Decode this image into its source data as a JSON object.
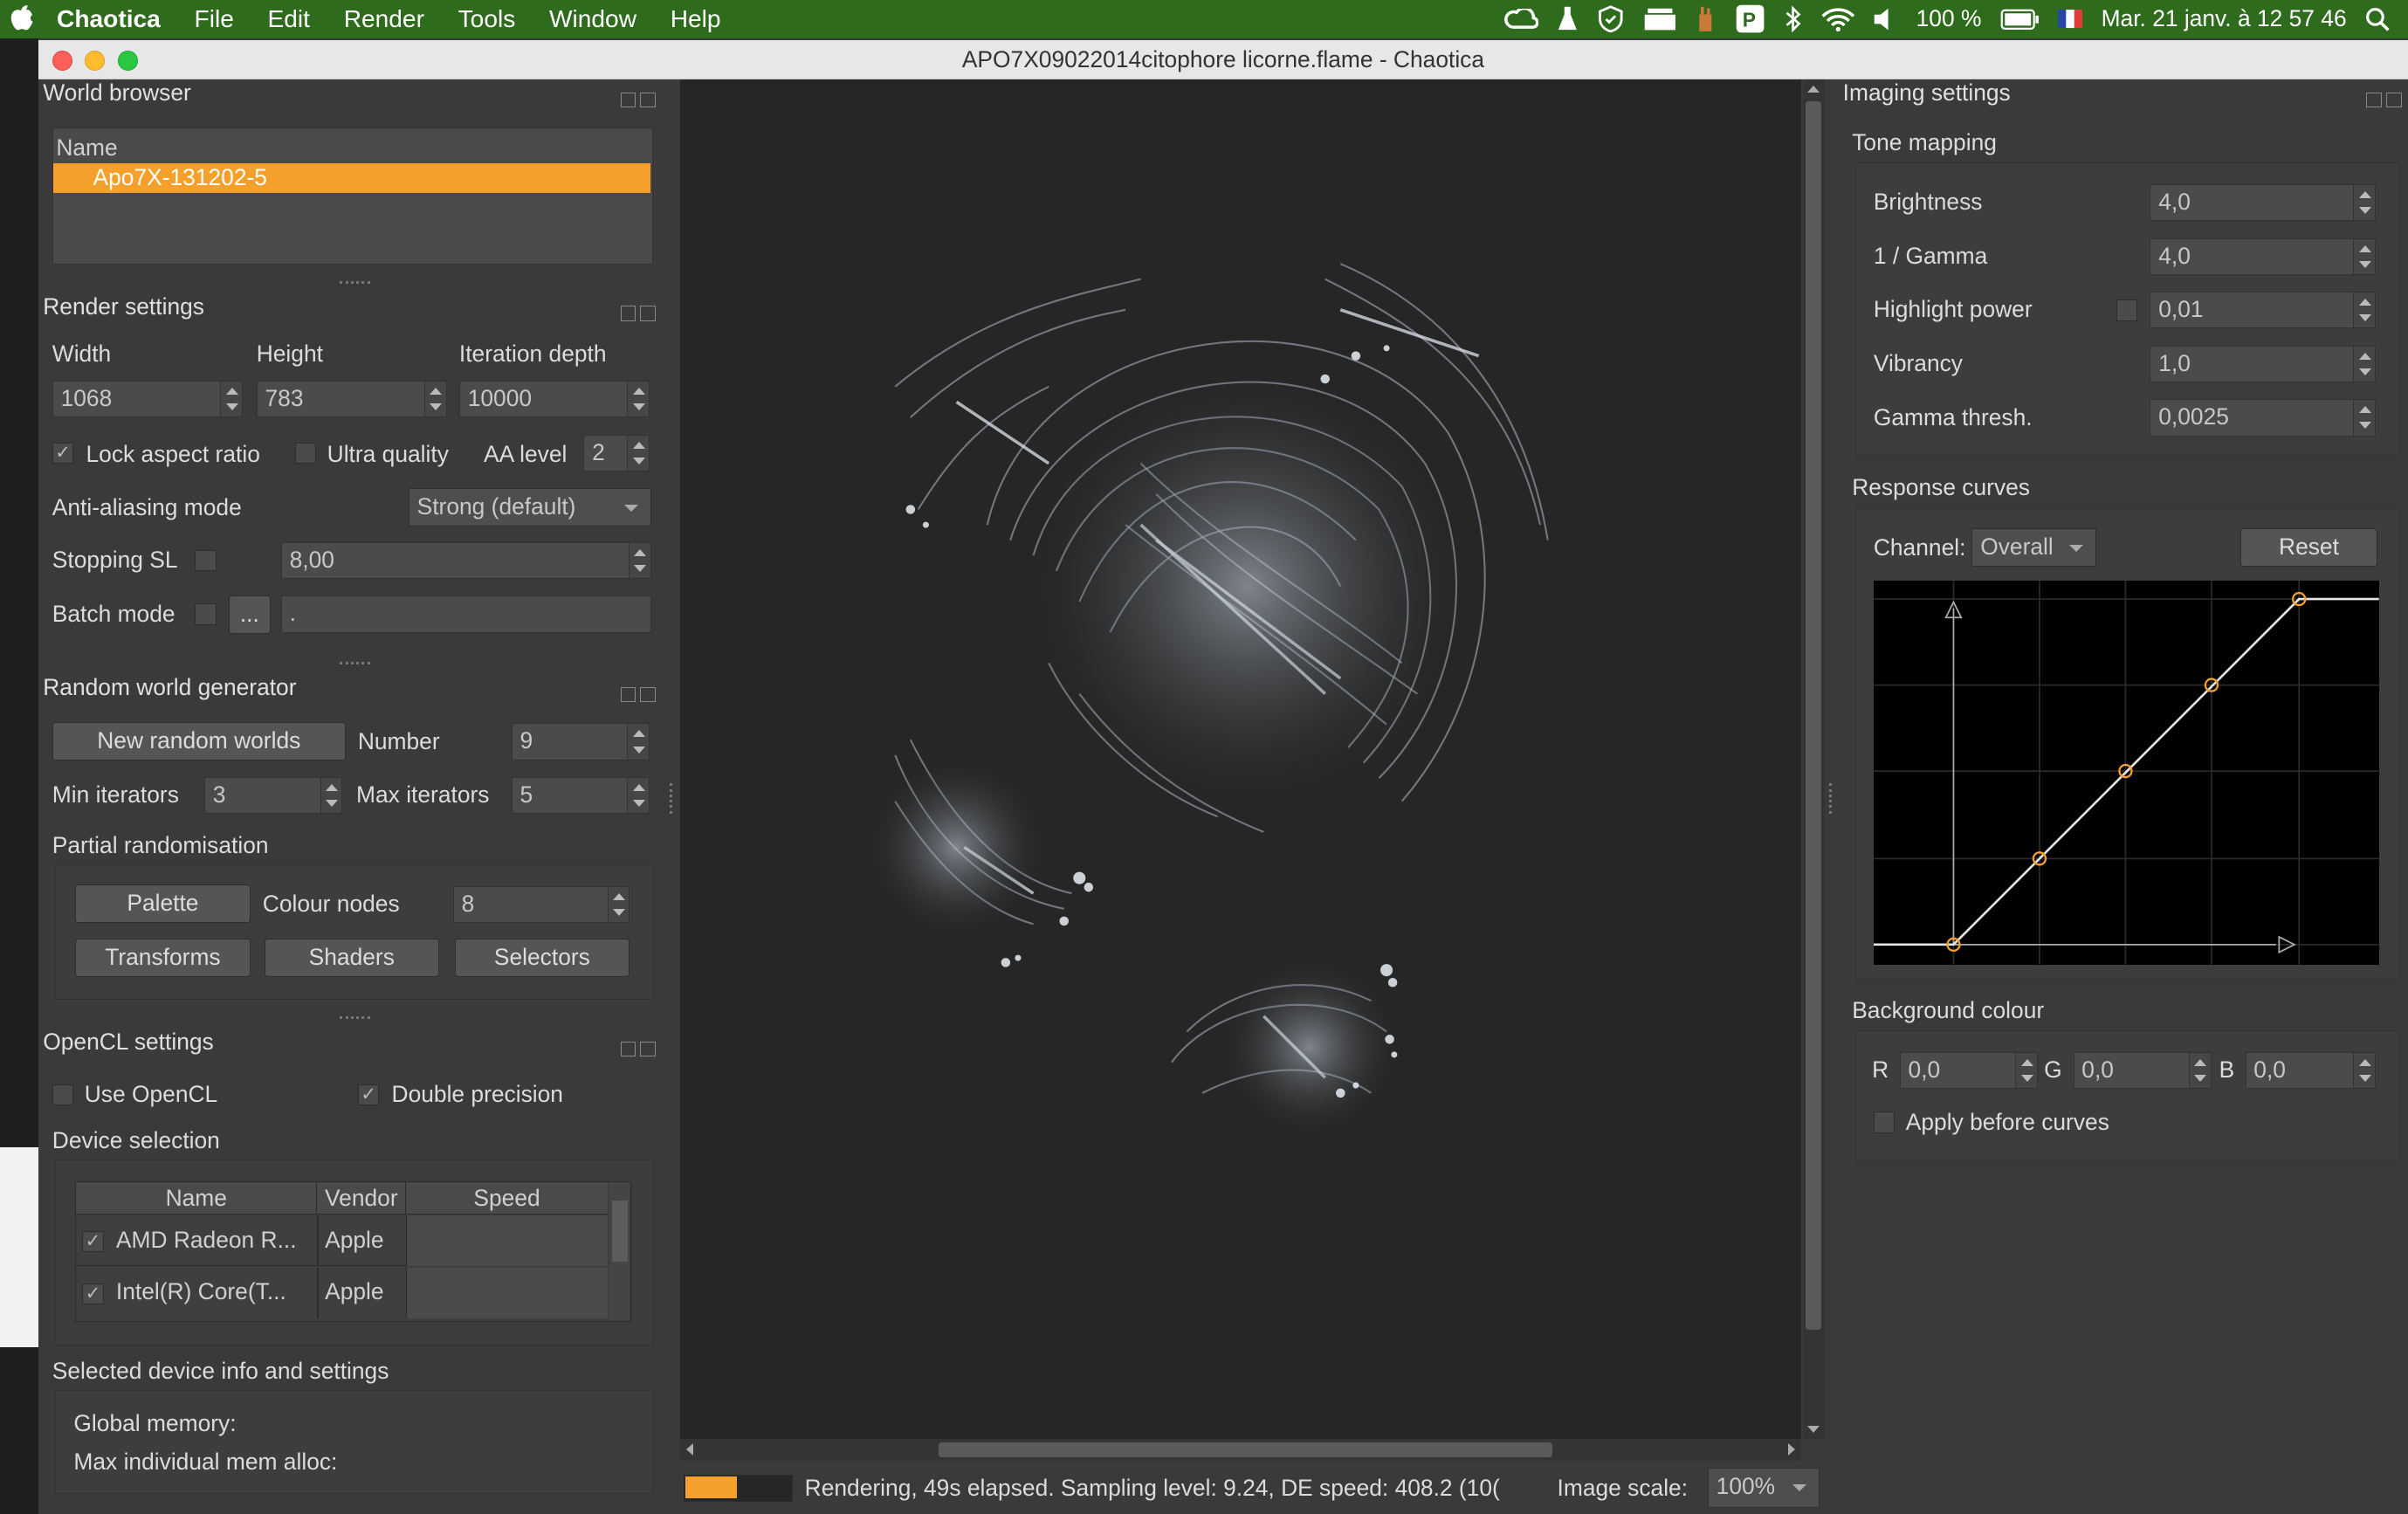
{
  "menubar": {
    "app_name": "Chaotica",
    "items": [
      "File",
      "Edit",
      "Render",
      "Tools",
      "Window",
      "Help"
    ],
    "battery": "100 %",
    "clock": "Mar. 21 janv. à  12 57 46"
  },
  "window": {
    "title": "APO7X09022014citophore licorne.flame - Chaotica"
  },
  "world_browser": {
    "title": "World browser",
    "column_name": "Name",
    "selected_item": "Apo7X-131202-5"
  },
  "render_settings": {
    "title": "Render settings",
    "width_label": "Width",
    "height_label": "Height",
    "depth_label": "Iteration depth",
    "width_value": "1068",
    "height_value": "783",
    "depth_value": "10000",
    "lock_aspect_label": "Lock aspect ratio",
    "ultra_quality_label": "Ultra quality",
    "aa_level_label": "AA level",
    "aa_level_value": "2",
    "aa_mode_label": "Anti-aliasing mode",
    "aa_mode_value": "Strong (default)",
    "stopping_sl_label": "Stopping SL",
    "stopping_sl_value": "8,00",
    "batch_mode_label": "Batch mode",
    "batch_browse": "...",
    "batch_path": "."
  },
  "random_world": {
    "title": "Random world generator",
    "new_button": "New random worlds",
    "number_label": "Number",
    "number_value": "9",
    "min_iter_label": "Min iterators",
    "min_iter_value": "3",
    "max_iter_label": "Max iterators",
    "max_iter_value": "5",
    "partial_label": "Partial randomisation",
    "palette_button": "Palette",
    "colour_nodes_label": "Colour nodes",
    "colour_nodes_value": "8",
    "transforms_button": "Transforms",
    "shaders_button": "Shaders",
    "selectors_button": "Selectors"
  },
  "opencl": {
    "title": "OpenCL settings",
    "use_opencl_label": "Use OpenCL",
    "double_precision_label": "Double precision",
    "device_selection_label": "Device selection",
    "columns": [
      "Name",
      "Vendor",
      "Speed"
    ],
    "devices": [
      {
        "name": "AMD Radeon R...",
        "vendor": "Apple",
        "speed": ""
      },
      {
        "name": "Intel(R) Core(T...",
        "vendor": "Apple",
        "speed": ""
      }
    ],
    "selected_info_label": "Selected device info and settings",
    "global_memory_label": "Global memory:",
    "max_alloc_label": "Max individual mem alloc:"
  },
  "statusbar": {
    "progress": 0.5,
    "status_text": "Rendering, 49s elapsed. Sampling level: 9.24, DE speed: 408.2 (10(",
    "image_scale_label": "Image scale:",
    "image_scale_value": "100%"
  },
  "imaging": {
    "title": "Imaging settings",
    "tone_mapping_label": "Tone mapping",
    "brightness_label": "Brightness",
    "brightness_value": "4,0",
    "gamma_label": "1 / Gamma",
    "gamma_value": "4,0",
    "highlight_label": "Highlight power",
    "highlight_value": "0,01",
    "vibrancy_label": "Vibrancy",
    "vibrancy_value": "1,0",
    "gamma_thresh_label": "Gamma thresh.",
    "gamma_thresh_value": "0,0025",
    "response_curves_label": "Response curves",
    "channel_label": "Channel:",
    "channel_value": "Overall",
    "reset_button": "Reset",
    "background_label": "Background colour",
    "r_label": "R",
    "r_value": "0,0",
    "g_label": "G",
    "g_value": "0,0",
    "b_label": "B",
    "b_value": "0,0",
    "apply_before_label": "Apply before curves"
  },
  "colors": {
    "accent": "#f5a02a",
    "menubar": "#2f6b1c",
    "panel": "#3a3a3a",
    "canvas": "#262626"
  }
}
